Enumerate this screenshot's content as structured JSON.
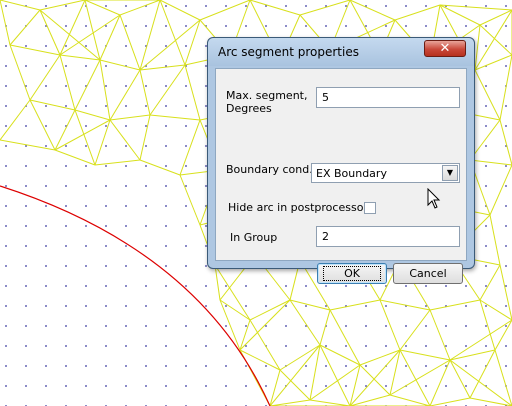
{
  "dialog": {
    "title": "Arc segment properties",
    "close_glyph": "✕",
    "max_segment_label": "Max. segment, Degrees",
    "max_segment_value": "5",
    "boundary_label": "Boundary cond.",
    "boundary_value": "EX Boundary",
    "hide_arc_label": "Hide arc in postprocessor",
    "hide_arc_checked": false,
    "in_group_label": "In Group",
    "in_group_value": "2",
    "ok_label": "OK",
    "cancel_label": "Cancel"
  },
  "colors": {
    "mesh": "#d8e01c",
    "arc": "#dd0000",
    "grid_dots": "#3a3aa0",
    "dialog_frame": "#aec7e2"
  },
  "icons": [
    "close-icon",
    "chevron-down-icon",
    "mouse-cursor-icon"
  ]
}
